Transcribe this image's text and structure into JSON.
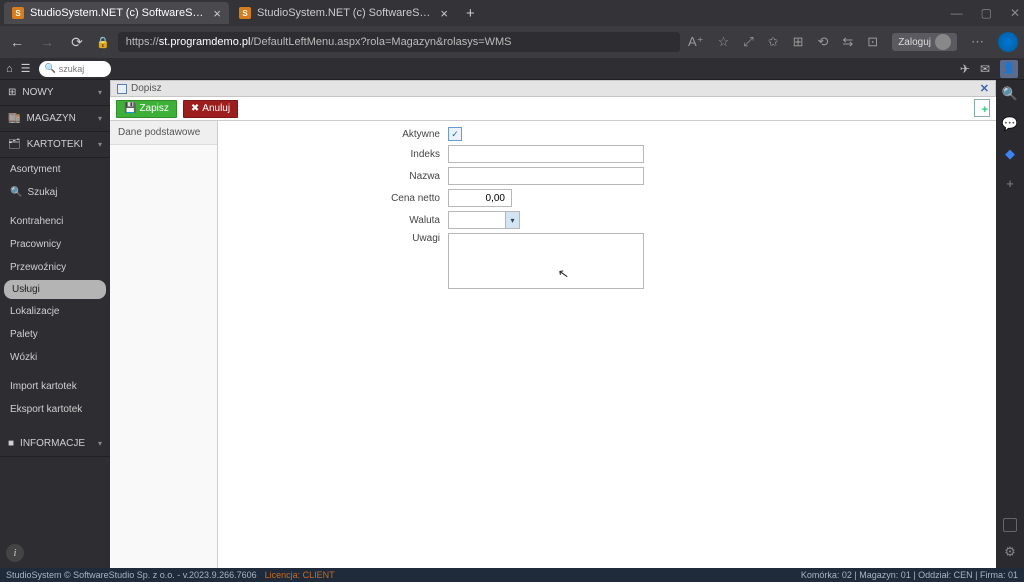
{
  "browser": {
    "tabs": [
      {
        "title": "StudioSystem.NET (c) SoftwareS…",
        "active": true
      },
      {
        "title": "StudioSystem.NET (c) SoftwareS…",
        "active": false
      }
    ],
    "url_prefix": "https://",
    "url_host": "st.programdemo.pl",
    "url_path": "/DefaultLeftMenu.aspx?rola=Magazyn&rolasys=WMS",
    "login_label": "Zaloguj"
  },
  "app_top": {
    "search_placeholder": "szukaj"
  },
  "sidebar": {
    "sections": {
      "nowy": "NOWY",
      "magazyn": "MAGAZYN",
      "kartoteki": "KARTOTEKI",
      "informacje": "INFORMACJE"
    },
    "items": {
      "asortyment": "Asortyment",
      "szukaj": "Szukaj",
      "kontrahenci": "Kontrahenci",
      "pracownicy": "Pracownicy",
      "przewoznicy": "Przewoźnicy",
      "uslugi": "Usługi",
      "lokalizacje": "Lokalizacje",
      "palety": "Palety",
      "wozki": "Wózki",
      "import_kartotek": "Import kartotek",
      "eksport_kartotek": "Eksport kartotek"
    }
  },
  "content": {
    "panel_title": "Dopisz",
    "save_label": "Zapisz",
    "cancel_label": "Anuluj",
    "left_tab": "Dane podstawowe",
    "fields": {
      "aktywne": "Aktywne",
      "indeks": "Indeks",
      "nazwa": "Nazwa",
      "cena_netto": "Cena netto",
      "cena_value": "0,00",
      "waluta": "Waluta",
      "uwagi": "Uwagi"
    }
  },
  "footer": {
    "left": "StudioSystem © SoftwareStudio Sp. z o.o. - v.2023.9.266.7606",
    "licencja": "Licencja: CLIENT",
    "right": "Komórka: 02 | Magazyn: 01 | Oddział: CEN | Firma: 01"
  }
}
